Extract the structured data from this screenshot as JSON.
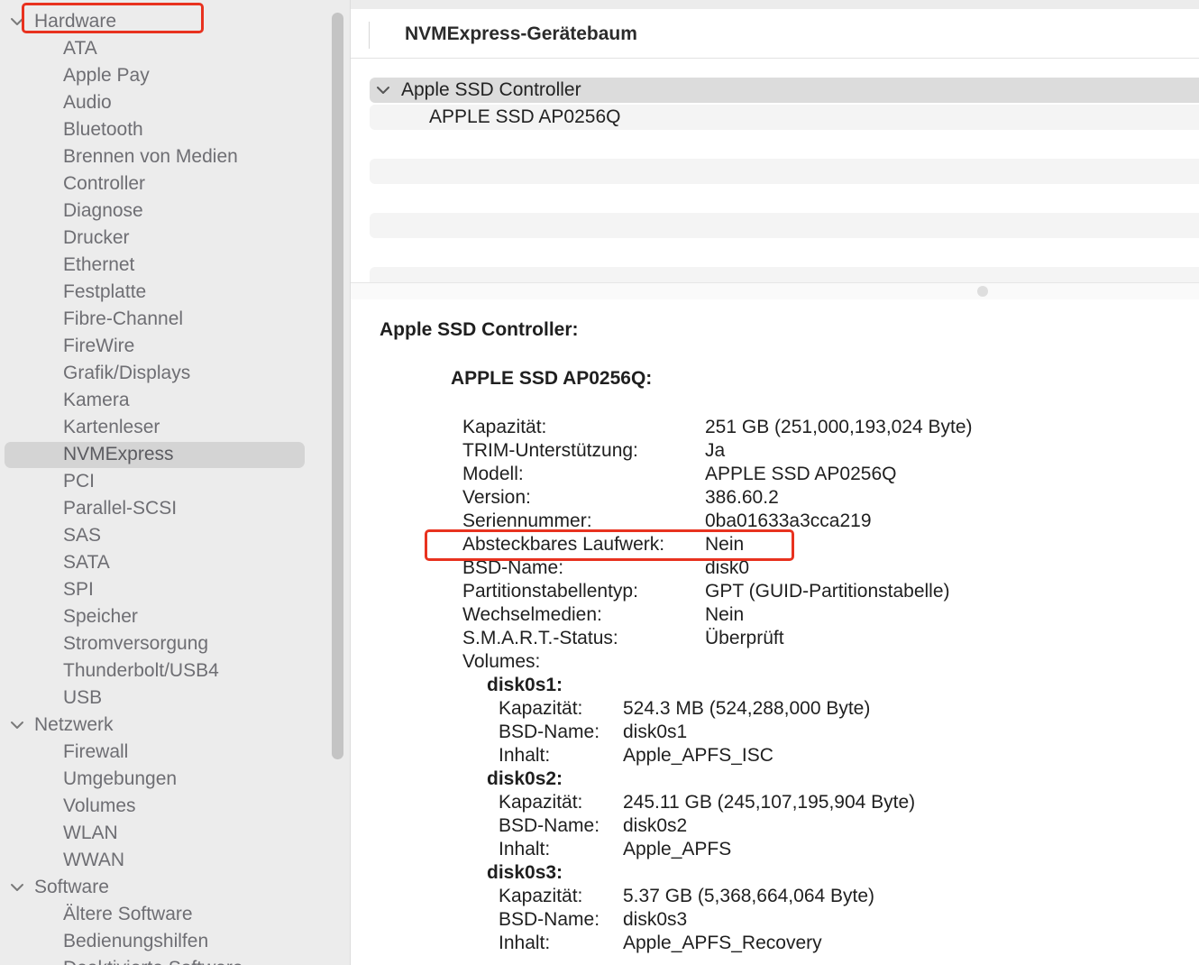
{
  "sidebar": {
    "groups": [
      {
        "label": "Hardware",
        "items": [
          "ATA",
          "Apple Pay",
          "Audio",
          "Bluetooth",
          "Brennen von Medien",
          "Controller",
          "Diagnose",
          "Drucker",
          "Ethernet",
          "Festplatte",
          "Fibre-Channel",
          "FireWire",
          "Grafik/Displays",
          "Kamera",
          "Kartenleser",
          "NVMExpress",
          "PCI",
          "Parallel-SCSI",
          "SAS",
          "SATA",
          "SPI",
          "Speicher",
          "Stromversorgung",
          "Thunderbolt/USB4",
          "USB"
        ]
      },
      {
        "label": "Netzwerk",
        "items": [
          "Firewall",
          "Umgebungen",
          "Volumes",
          "WLAN",
          "WWAN"
        ]
      },
      {
        "label": "Software",
        "items": [
          "Ältere Software",
          "Bedienungshilfen",
          "Deaktivierte Software"
        ]
      }
    ],
    "selected": "NVMExpress",
    "highlighted_group": "Hardware"
  },
  "header": {
    "title": "NVMExpress-Gerätebaum"
  },
  "tree": {
    "controller": "Apple SSD Controller",
    "device": "APPLE SSD AP0256Q"
  },
  "detail": {
    "section_title": "Apple SSD Controller:",
    "device_title": "APPLE SSD AP0256Q:",
    "properties": [
      {
        "label": "Kapazität:",
        "value": "251 GB (251,000,193,024 Byte)"
      },
      {
        "label": "TRIM-Unterstützung:",
        "value": "Ja"
      },
      {
        "label": "Modell:",
        "value": "APPLE SSD AP0256Q"
      },
      {
        "label": "Version:",
        "value": "386.60.2"
      },
      {
        "label": "Seriennummer:",
        "value": "0ba01633a3cca219"
      },
      {
        "label": "Absteckbares Laufwerk:",
        "value": "Nein"
      },
      {
        "label": "BSD-Name:",
        "value": "disk0"
      },
      {
        "label": "Partitionstabellentyp:",
        "value": "GPT (GUID-Partitionstabelle)"
      },
      {
        "label": "Wechselmedien:",
        "value": "Nein"
      },
      {
        "label": "S.M.A.R.T.-Status:",
        "value": "Überprüft"
      },
      {
        "label": "Volumes:",
        "value": ""
      }
    ],
    "volumes": [
      {
        "name": "disk0s1:",
        "props": [
          {
            "label": "Kapazität:",
            "value": "524.3 MB (524,288,000 Byte)"
          },
          {
            "label": "BSD-Name:",
            "value": "disk0s1"
          },
          {
            "label": "Inhalt:",
            "value": "Apple_APFS_ISC"
          }
        ]
      },
      {
        "name": "disk0s2:",
        "props": [
          {
            "label": "Kapazität:",
            "value": "245.11 GB (245,107,195,904 Byte)"
          },
          {
            "label": "BSD-Name:",
            "value": "disk0s2"
          },
          {
            "label": "Inhalt:",
            "value": "Apple_APFS"
          }
        ]
      },
      {
        "name": "disk0s3:",
        "props": [
          {
            "label": "Kapazität:",
            "value": "5.37 GB (5,368,664,064 Byte)"
          },
          {
            "label": "BSD-Name:",
            "value": "disk0s3"
          },
          {
            "label": "Inhalt:",
            "value": "Apple_APFS_Recovery"
          }
        ]
      }
    ],
    "highlighted_property": "Absteckbares Laufwerk:"
  },
  "colors": {
    "annotation_red": "#e8321f",
    "selection_gray": "#d4d4d4"
  }
}
